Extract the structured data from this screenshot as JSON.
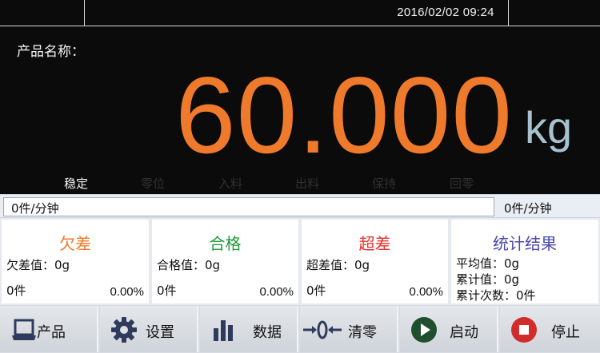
{
  "header": {
    "datetime": "2016/02/02  09:24"
  },
  "display": {
    "product_label": "产品名称：",
    "weight": "60.000",
    "unit": "kg",
    "status_items": [
      {
        "label": "稳定",
        "active": true
      },
      {
        "label": "零位",
        "active": false
      },
      {
        "label": "入料",
        "active": false
      },
      {
        "label": "出料",
        "active": false
      },
      {
        "label": "保持",
        "active": false
      },
      {
        "label": "回零",
        "active": false
      }
    ]
  },
  "rate": {
    "left_value": "0件/分钟",
    "right_value": "0件/分钟"
  },
  "panels": {
    "under": {
      "title": "欠差",
      "color": "#f07a2c",
      "value_line": "欠差值：0g",
      "count": "0件",
      "percent": "0.00%"
    },
    "pass": {
      "title": "合格",
      "color": "#1f9a3b",
      "value_line": "合格值：0g",
      "count": "0件",
      "percent": "0.00%"
    },
    "over": {
      "title": "超差",
      "color": "#e5322d",
      "value_line": "超差值：0g",
      "count": "0件",
      "percent": "0.00%"
    },
    "stats": {
      "title": "统计结果",
      "color": "#4a4aa8",
      "average": "平均值：0g",
      "total": "累计值：0g",
      "count": "累计次数：0件"
    }
  },
  "buttons": {
    "product": "产品",
    "settings": "设置",
    "data": "数据",
    "tare": "清零",
    "start": "启动",
    "stop": "停止"
  }
}
